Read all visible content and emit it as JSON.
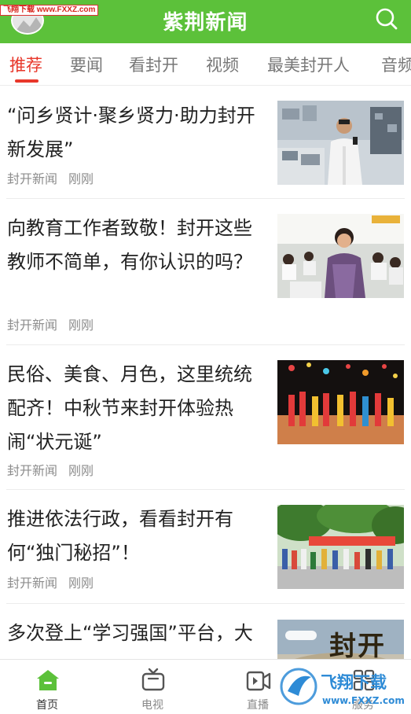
{
  "header": {
    "watermark": "飞翔下载 www.FXXZ.com",
    "title": "紫荆新闻"
  },
  "tabs": [
    {
      "label": "推荐",
      "active": true
    },
    {
      "label": "要闻"
    },
    {
      "label": "看封开"
    },
    {
      "label": "视频"
    },
    {
      "label": "最美封开人"
    },
    {
      "label": "音频"
    }
  ],
  "news": [
    {
      "title": "“问乡贤计·聚乡贤力·助力封开新发展”",
      "source": "封开新闻",
      "time": "刚刚"
    },
    {
      "title": "向教育工作者致敬！封开这些教师不简单，有你认识的吗？",
      "source": "封开新闻",
      "time": "刚刚"
    },
    {
      "title": "民俗、美食、月色，这里统统配齐！中秋节来封开体验热闹“状元诞”",
      "source": "封开新闻",
      "time": "刚刚"
    },
    {
      "title": "推进依法行政，看看封开有何“独门秘招”！",
      "source": "封开新闻",
      "time": "刚刚"
    },
    {
      "title": "多次登上“学习强国”平台，大",
      "source": "",
      "time": ""
    }
  ],
  "thumb_text": {
    "banner_5": "封开"
  },
  "bottom_nav": [
    {
      "label": "首页",
      "icon": "home-icon",
      "active": true
    },
    {
      "label": "电视",
      "icon": "tv-icon"
    },
    {
      "label": "直播",
      "icon": "live-icon"
    },
    {
      "label": "服务",
      "icon": "service-icon"
    }
  ],
  "brand_watermark": {
    "name": "飞翔下载",
    "url": "www.FXXZ.com"
  },
  "colors": {
    "header_green": "#5cc13a",
    "active_tab_red": "#e8372a",
    "nav_active_green": "#5cc13a"
  }
}
